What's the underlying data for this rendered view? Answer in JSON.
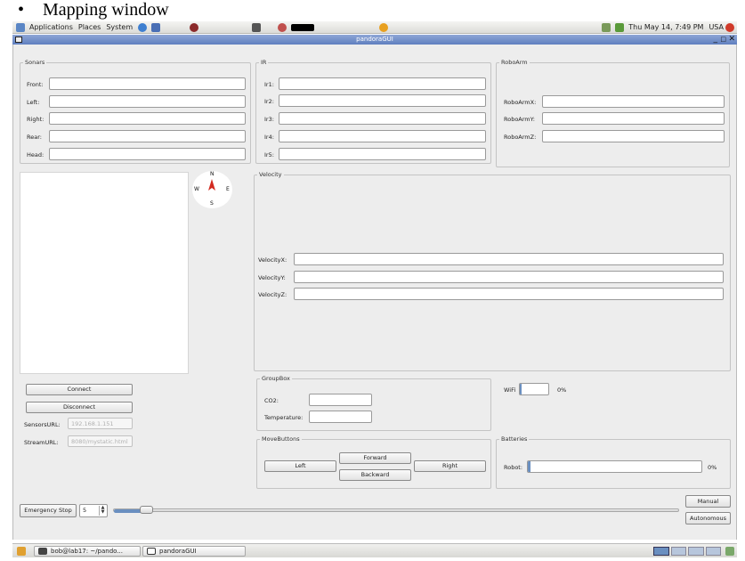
{
  "document": {
    "bullet": "•",
    "heading": "Mapping window"
  },
  "top_panel": {
    "menus": [
      "Applications",
      "Places",
      "System"
    ],
    "clock": "Thu May 14,  7:49 PM",
    "keyboard_layout": "USA"
  },
  "window": {
    "title": "pandoraGUI",
    "controls": [
      "_",
      "□",
      "✕"
    ]
  },
  "sonars": {
    "title": "Sonars",
    "labels": [
      "Front:",
      "Left:",
      "Right:",
      "Rear:",
      "Head:"
    ]
  },
  "ir": {
    "title": "IR",
    "labels": [
      "Ir1:",
      "Ir2:",
      "Ir3:",
      "Ir4:",
      "Ir5:"
    ]
  },
  "roboarm": {
    "title": "RoboArm",
    "labels": [
      "RoboArmX:",
      "RoboArmY:",
      "RoboArmZ:"
    ]
  },
  "compass": {
    "n": "N",
    "s": "S",
    "e": "E",
    "w": "W"
  },
  "velocity": {
    "title": "Velocity",
    "labels": [
      "VelocityX:",
      "VelocityY:",
      "VelocityZ:"
    ]
  },
  "connection": {
    "connect_label": "Connect",
    "disconnect_label": "Disconnect",
    "sensors_url_label": "SensorsURL:",
    "sensors_url_value": "192.168.1.151",
    "stream_url_label": "StreamURL:",
    "stream_url_value": "8080/mystatic.html"
  },
  "groupbox": {
    "title": "GroupBox",
    "co2_label": "CO2:",
    "temperature_label": "Temperature:"
  },
  "wifi": {
    "label": "WiFi",
    "value_text": "0%",
    "level": 0.05
  },
  "move_buttons": {
    "title": "MoveButtons",
    "left": "Left",
    "forward": "Forward",
    "backward": "Backward",
    "right": "Right"
  },
  "batteries": {
    "title": "Batteries",
    "robot_label": "Robot:",
    "value_text": "0%",
    "level": 0.01
  },
  "controls": {
    "emergency_stop": "Emergency Stop",
    "speed_value": "5",
    "manual": "Manual",
    "autonomous": "Autonomous"
  },
  "taskbar": {
    "terminal": "bob@lab17: ~/pando...",
    "app": "pandoraGUI"
  },
  "colors": {
    "title_bar": "#6f8cc9",
    "progress_fill": "#6a8fc0",
    "window_bg": "#ededed"
  }
}
